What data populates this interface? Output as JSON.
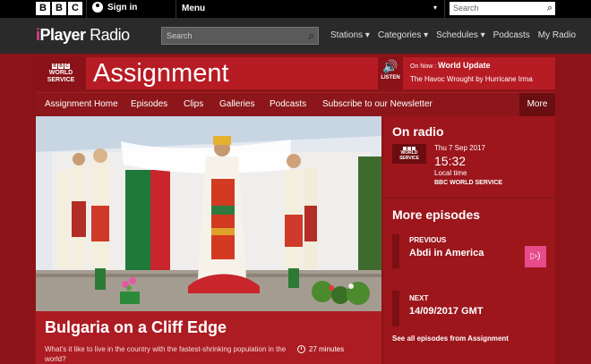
{
  "top_bar": {
    "logo_letters": [
      "B",
      "B",
      "C"
    ],
    "sign_in": "Sign in",
    "menu": "Menu",
    "search_placeholder": "Search"
  },
  "radio_bar": {
    "brand_i": "i",
    "brand_player": "Player",
    "brand_radio": "Radio",
    "search_placeholder": "Search",
    "nav": [
      "Stations",
      "Categories",
      "Schedules",
      "Podcasts",
      "My Radio"
    ]
  },
  "programme": {
    "logo_text": "WORLD SERVICE",
    "title": "Assignment",
    "listen_label": "LISTEN",
    "on_now_label": "On Now :",
    "on_now_station": "World Update",
    "on_now_episode": "The Havoc Wrought by Hurricane Irma"
  },
  "prog_nav": {
    "items": [
      "Assignment Home",
      "Episodes",
      "Clips",
      "Galleries",
      "Podcasts",
      "Subscribe to our Newsletter"
    ],
    "more": "More"
  },
  "feature": {
    "title": "Bulgaria on a Cliff Edge",
    "description": "What's it like to live in the country with the fastest-shrinking population in the world?",
    "duration": "27 minutes"
  },
  "on_radio": {
    "heading": "On radio",
    "date": "Thu 7 Sep 2017",
    "time": "15:32",
    "local": "Local time",
    "station": "BBC WORLD SERVICE"
  },
  "more_episodes": {
    "heading": "More episodes",
    "previous_label": "PREVIOUS",
    "previous_title": "Abdi in America",
    "next_label": "NEXT",
    "next_date": "14/09/2017 GMT",
    "see_all": "See all episodes from Assignment"
  },
  "colors": {
    "brand_red": "#b71c24",
    "page_red": "#8c1418",
    "iplayer_pink": "#e84b8a"
  }
}
